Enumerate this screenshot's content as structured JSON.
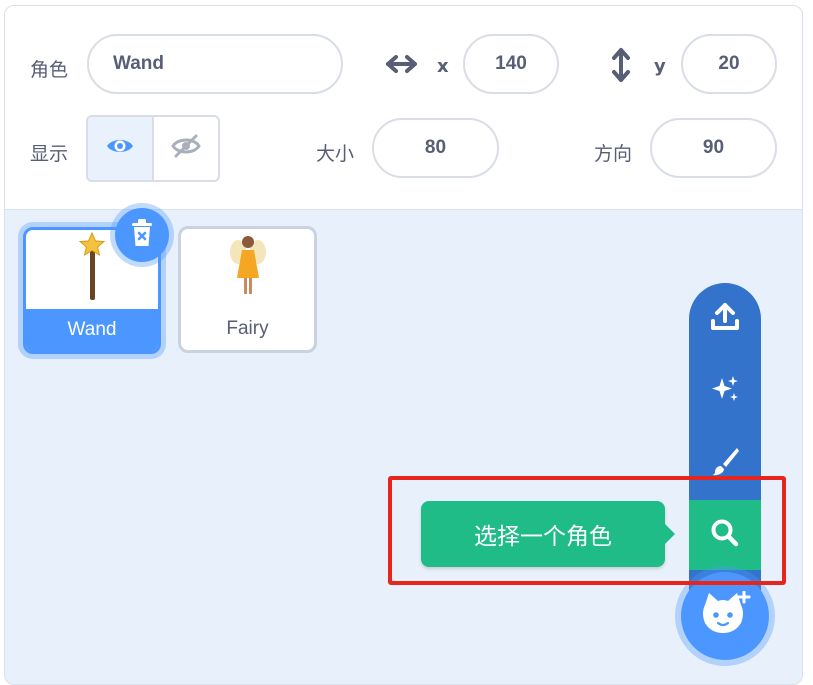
{
  "sprite_info": {
    "sprite_label": "角色",
    "sprite_name": "Wand",
    "x_label": "x",
    "x_value": "140",
    "y_label": "y",
    "y_value": "20",
    "show_label": "显示",
    "size_label": "大小",
    "size_value": "80",
    "direction_label": "方向",
    "direction_value": "90"
  },
  "sprites": [
    {
      "name": "Wand",
      "selected": true,
      "icon": "wand-icon"
    },
    {
      "name": "Fairy",
      "selected": false,
      "icon": "fairy-icon"
    }
  ],
  "sprite_menu": {
    "items": [
      "upload-icon",
      "surprise-sparkle-icon",
      "paint-brush-icon",
      "search-icon"
    ],
    "tooltip": "选择一个角色",
    "main_icon": "cat-add-icon"
  },
  "colors": {
    "accent": "#4c97ff",
    "menu": "#3373cc",
    "search": "#1fbc87",
    "highlight": "#e8251d"
  }
}
